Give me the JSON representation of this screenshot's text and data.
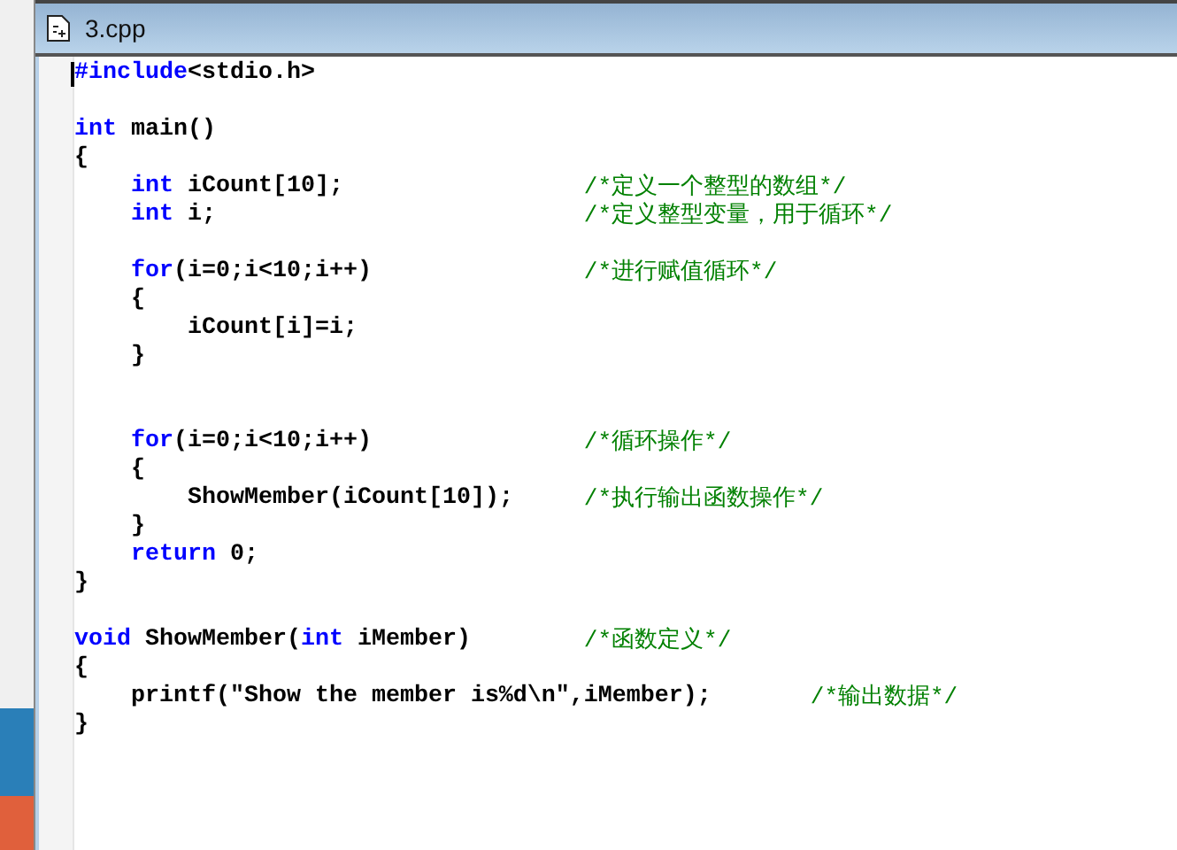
{
  "window": {
    "title": "3.cpp"
  },
  "editor": {
    "lines": [
      {
        "kind": "code",
        "tokens": [
          {
            "kind": "keyword",
            "text": "#include"
          },
          {
            "kind": "text",
            "text": "<stdio.h>"
          }
        ]
      },
      {
        "kind": "blank"
      },
      {
        "kind": "code",
        "tokens": [
          {
            "kind": "keyword",
            "text": "int"
          },
          {
            "kind": "text",
            "text": " main()"
          }
        ]
      },
      {
        "kind": "code",
        "tokens": [
          {
            "kind": "text",
            "text": "{"
          }
        ],
        "children": [
          {
            "kind": "code",
            "tokens": [
              {
                "kind": "keyword",
                "text": "int"
              },
              {
                "kind": "text",
                "text": " iCount[10];"
              }
            ],
            "comment": "/*定义一个整型的数组*/"
          },
          {
            "kind": "code",
            "tokens": [
              {
                "kind": "keyword",
                "text": "int"
              },
              {
                "kind": "text",
                "text": " i;"
              }
            ],
            "comment": "/*定义整型变量，用于循环*/"
          },
          {
            "kind": "blank"
          },
          {
            "kind": "code",
            "tokens": [
              {
                "kind": "keyword",
                "text": "for"
              },
              {
                "kind": "text",
                "text": "(i=0;i<10;i++)"
              }
            ],
            "comment": "/*进行赋值循环*/"
          },
          {
            "kind": "code",
            "tokens": [
              {
                "kind": "text",
                "text": "{"
              }
            ],
            "children": [
              {
                "kind": "code",
                "tokens": [
                  {
                    "kind": "text",
                    "text": "iCount[i]=i;"
                  }
                ]
              }
            ]
          },
          {
            "kind": "code",
            "tokens": [
              {
                "kind": "text",
                "text": "}"
              }
            ]
          },
          {
            "kind": "blank"
          },
          {
            "kind": "blank"
          },
          {
            "kind": "code",
            "tokens": [
              {
                "kind": "keyword",
                "text": "for"
              },
              {
                "kind": "text",
                "text": "(i=0;i<10;i++)"
              }
            ],
            "comment": "/*循环操作*/"
          },
          {
            "kind": "code",
            "tokens": [
              {
                "kind": "text",
                "text": "{"
              }
            ],
            "children": [
              {
                "kind": "code",
                "tokens": [
                  {
                    "kind": "text",
                    "text": "ShowMember(iCount[10]);"
                  }
                ],
                "comment": "/*执行输出函数操作*/"
              }
            ]
          },
          {
            "kind": "code",
            "tokens": [
              {
                "kind": "text",
                "text": "}"
              }
            ]
          },
          {
            "kind": "code",
            "tokens": [
              {
                "kind": "keyword",
                "text": "return"
              },
              {
                "kind": "text",
                "text": " 0;"
              }
            ]
          }
        ]
      },
      {
        "kind": "code",
        "tokens": [
          {
            "kind": "text",
            "text": "}"
          }
        ]
      },
      {
        "kind": "blank"
      },
      {
        "kind": "code",
        "tokens": [
          {
            "kind": "keyword",
            "text": "void"
          },
          {
            "kind": "text",
            "text": " ShowMember("
          },
          {
            "kind": "keyword",
            "text": "int"
          },
          {
            "kind": "text",
            "text": " iMember)"
          }
        ],
        "comment": "/*函数定义*/"
      },
      {
        "kind": "code",
        "tokens": [
          {
            "kind": "text",
            "text": "{"
          }
        ],
        "children": [
          {
            "kind": "code",
            "tokens": [
              {
                "kind": "text",
                "text": "printf(\"Show the member is%d\\n\",iMember);"
              }
            ],
            "comment": "/*输出数据*/"
          }
        ]
      },
      {
        "kind": "code",
        "tokens": [
          {
            "kind": "text",
            "text": "}"
          }
        ]
      }
    ]
  }
}
